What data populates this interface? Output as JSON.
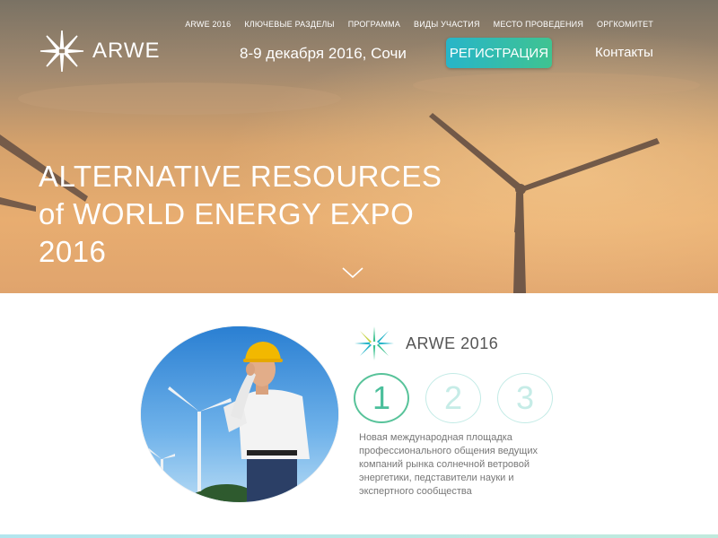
{
  "brand": {
    "name": "ARWE",
    "icon": "star-burst-icon"
  },
  "nav": {
    "items": [
      {
        "label": "ARWE 2016"
      },
      {
        "label": "КЛЮЧЕВЫЕ РАЗДЕЛЫ"
      },
      {
        "label": "ПРОГРАММА"
      },
      {
        "label": "ВИДЫ УЧАСТИЯ"
      },
      {
        "label": "МЕСТО ПРОВЕДЕНИЯ"
      },
      {
        "label": "ОРГКОМИТЕТ"
      }
    ]
  },
  "header": {
    "date_location": "8-9 декабря 2016, Сочи",
    "register_label": "РЕГИСТРАЦИЯ",
    "contacts_label": "Контакты"
  },
  "hero": {
    "title_lines": [
      "ALTERNATIVE RESOURCES",
      "of WORLD ENERGY EXPO",
      "2016"
    ],
    "scroll_icon": "chevron-down-icon"
  },
  "about": {
    "title": "ARWE 2016",
    "steps": [
      {
        "label": "1",
        "active": true
      },
      {
        "label": "2",
        "active": false
      },
      {
        "label": "3",
        "active": false
      }
    ],
    "description": "Новая международная площадка профессионального общения ведущих компаний рынка солнечной ветровой энергетики, педставители науки и экспертного сообщества"
  },
  "colors": {
    "accent_start": "#27b5c9",
    "accent_end": "#3fc391",
    "text_muted": "#777777"
  }
}
